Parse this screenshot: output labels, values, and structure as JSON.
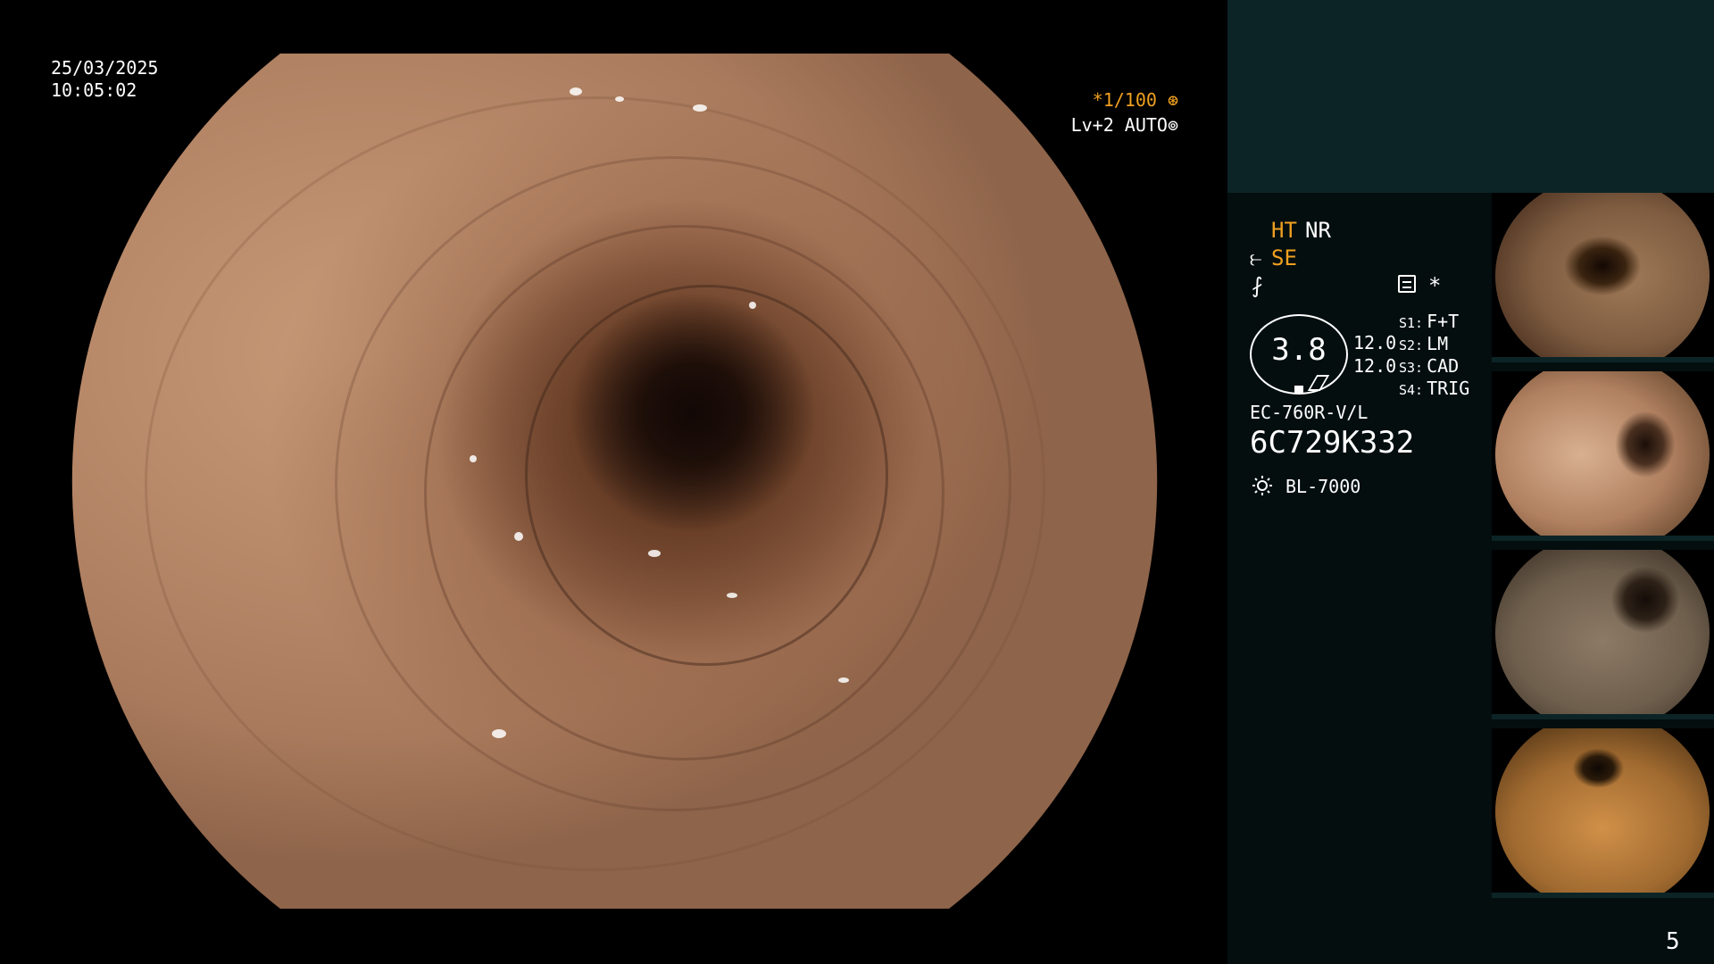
{
  "overlay": {
    "date": "25/03/2025",
    "time": "10:05:02",
    "shutter": "*1/100",
    "shutter_icon": "aperture-icon",
    "level": "Lv+2 AUTO",
    "level_icon": "iris-icon"
  },
  "status": {
    "ht": "HT",
    "nr": "NR",
    "se_icon": "⥼",
    "se": "SE",
    "f_icon": "⨏",
    "asterisk": "*",
    "gauge_value": "3.8",
    "value_1": "12.0",
    "value_2": "12.0",
    "slots": [
      {
        "key": "S1:",
        "value": "F+T"
      },
      {
        "key": "S2:",
        "value": "LM"
      },
      {
        "key": "S3:",
        "value": "CAD"
      },
      {
        "key": "S4:",
        "value": "TRIG"
      }
    ],
    "model": "EC-760R-V/L",
    "serial": "6C729K332",
    "light_source": "BL-7000"
  },
  "colors": {
    "accent": "#f0a020",
    "panel_top": "#0c2426",
    "panel": "#040e0f"
  },
  "footer": {
    "page": "5"
  }
}
